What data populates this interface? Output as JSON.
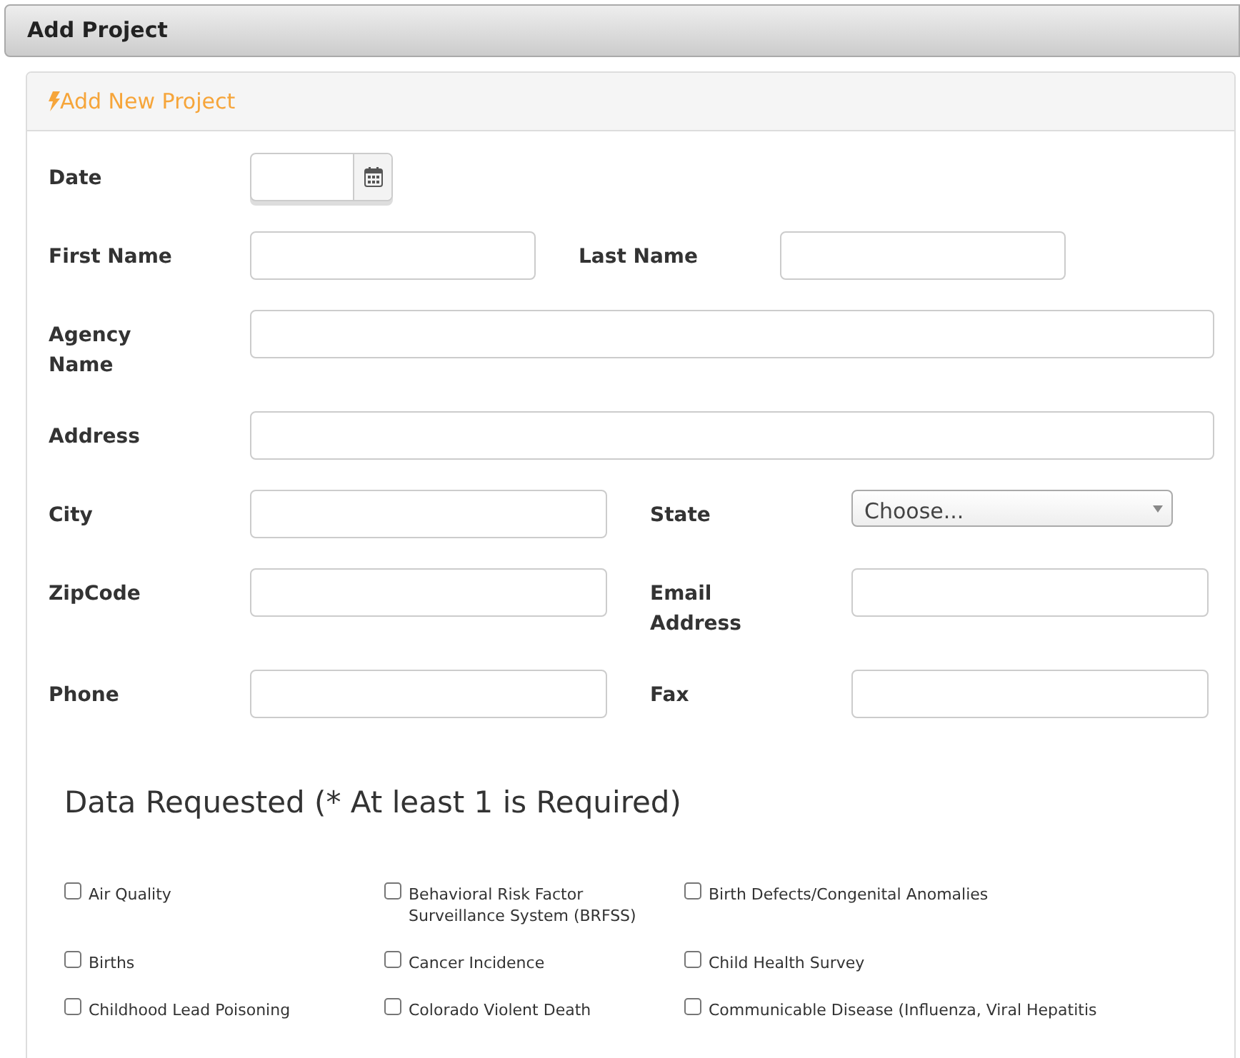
{
  "page_title": "Add Project",
  "panel": {
    "title": "Add New Project"
  },
  "form_rows": [
    {
      "fields": [
        {
          "kind": "date",
          "label": "Date"
        }
      ]
    },
    {
      "fields": [
        {
          "kind": "text",
          "label": "First Name"
        },
        {
          "kind": "text",
          "label": "Last Name"
        }
      ]
    },
    {
      "fields": [
        {
          "kind": "text",
          "label": "Agency Name"
        }
      ]
    },
    {
      "fields": [
        {
          "kind": "text",
          "label": "Address"
        }
      ]
    },
    {
      "fields": [
        {
          "kind": "text",
          "label": "City"
        },
        {
          "kind": "select",
          "label": "State",
          "value": "Choose..."
        }
      ]
    },
    {
      "fields": [
        {
          "kind": "text",
          "label": "ZipCode"
        },
        {
          "kind": "text",
          "label": "Email Address"
        }
      ]
    },
    {
      "fields": [
        {
          "kind": "text",
          "label": "Phone"
        },
        {
          "kind": "text",
          "label": "Fax"
        }
      ]
    }
  ],
  "data_requested": {
    "heading": "Data Requested (* At least 1 is Required)",
    "options": [
      {
        "label": "Air Quality",
        "checked": false
      },
      {
        "label": "Behavioral Risk Factor Surveillance System (BRFSS)",
        "checked": false
      },
      {
        "label": "Birth Defects/Congenital Anomalies",
        "checked": false
      },
      {
        "label": "Births",
        "checked": false
      },
      {
        "label": "Cancer Incidence",
        "checked": false
      },
      {
        "label": "Child Health Survey",
        "checked": false
      },
      {
        "label": "Childhood Lead Poisoning",
        "checked": false
      },
      {
        "label": "Colorado Violent Death",
        "checked": false
      },
      {
        "label": "Communicable Disease (Influenza, Viral Hepatitis",
        "checked": false
      }
    ]
  }
}
